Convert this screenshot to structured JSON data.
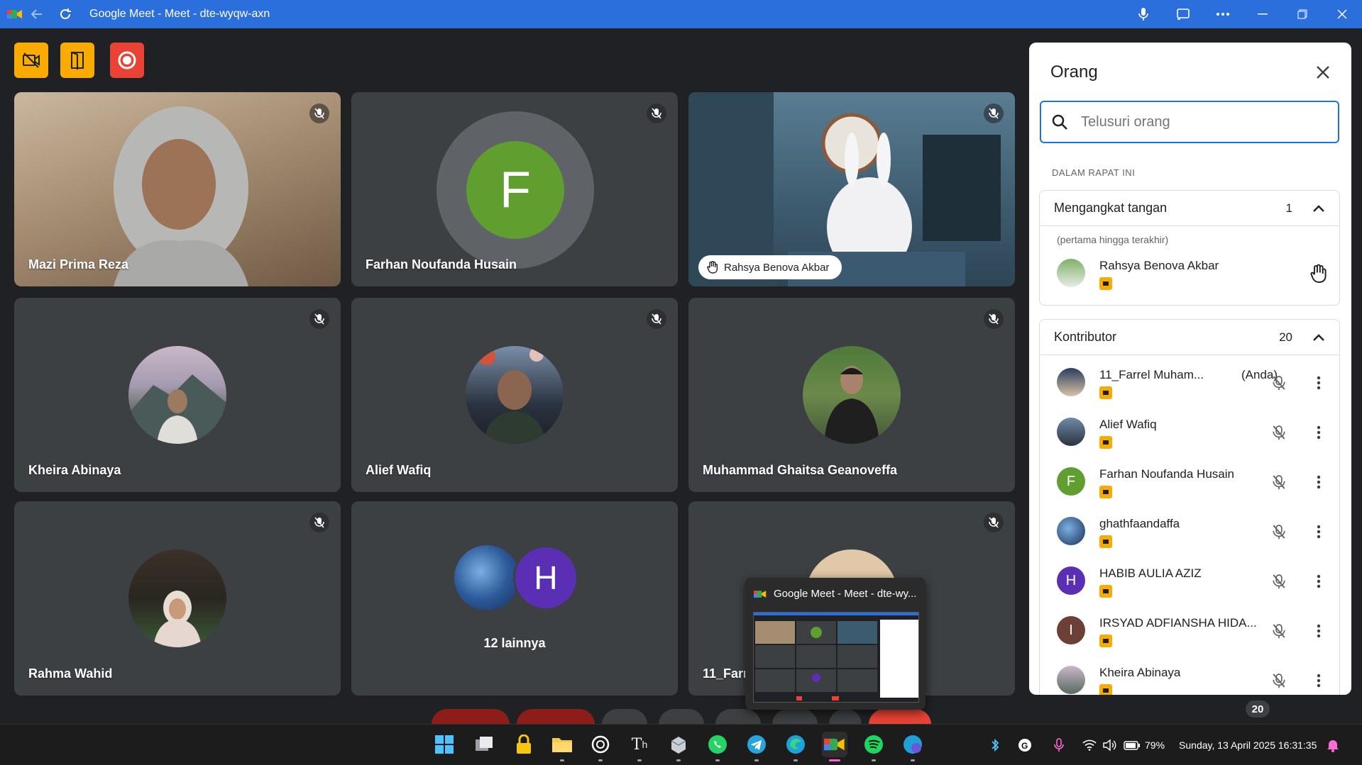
{
  "window": {
    "title": "Google Meet - Meet - dte-wyqw-axn",
    "icons": [
      "meet-app-icon",
      "back-arrow-icon",
      "reload-icon",
      "microphone-icon",
      "cast-icon",
      "more-horizontal-icon",
      "minimize-icon",
      "restore-icon",
      "close-icon"
    ]
  },
  "host_controls": [
    {
      "name": "camera-off-host-control",
      "color": "#f9ab00"
    },
    {
      "name": "exit-host-control",
      "color": "#f9ab00"
    },
    {
      "name": "record-host-control",
      "color": "#ea4335"
    }
  ],
  "tiles": [
    {
      "name": "Mazi Prima Reza",
      "type": "video"
    },
    {
      "name": "Farhan Noufanda Husain",
      "type": "initial",
      "initial": "F",
      "color": "#5f9e2f"
    },
    {
      "name": "Rahsya Benova Akbar",
      "type": "video",
      "hand_raised": true
    },
    {
      "name": "Kheira Abinaya",
      "type": "photo"
    },
    {
      "name": "Alief Wafiq",
      "type": "photo"
    },
    {
      "name": "Muhammad Ghaitsa Geanoveffa",
      "type": "photo"
    },
    {
      "name": "Rahma Wahid",
      "type": "photo"
    },
    {
      "name": "12 lainnya",
      "type": "group",
      "initial": "H"
    },
    {
      "name": "11_Farr",
      "type": "photo"
    }
  ],
  "panel": {
    "title": "Orang",
    "search_placeholder": "Telusuri orang",
    "section_label": "DALAM RAPAT INI",
    "raised_hands": {
      "title": "Mengangkat tangan",
      "count": "1",
      "note": "(pertama hingga terakhir)",
      "people": [
        {
          "name": "Rahsya Benova Akbar"
        }
      ]
    },
    "contributors": {
      "title": "Kontributor",
      "count": "20",
      "people": [
        {
          "name": "11_Farrel Muham...",
          "you": "(Anda)",
          "avatar": "photo"
        },
        {
          "name": "Alief Wafiq",
          "you": "",
          "avatar": "photo"
        },
        {
          "name": "Farhan Noufanda Husain",
          "you": "",
          "avatar": "F",
          "color": "#5f9e2f"
        },
        {
          "name": "ghathfaandaffa",
          "you": "",
          "avatar": "photo"
        },
        {
          "name": "HABIB AULIA AZIZ",
          "you": "",
          "avatar": "H",
          "color": "#5b2fb3"
        },
        {
          "name": "IRSYAD ADFIANSHA HIDA...",
          "you": "",
          "avatar": "I",
          "color": "#6d4037"
        },
        {
          "name": "Kheira Abinaya",
          "you": "",
          "avatar": "photo"
        }
      ]
    }
  },
  "preview": {
    "title": "Google Meet - Meet - dte-wy..."
  },
  "taskbar": {
    "notification_count": "20",
    "battery": "79%",
    "datetime": "Sunday, 13 April 2025  16:31:35",
    "apps": [
      "windows-start-icon",
      "task-view-icon",
      "lock-app-icon",
      "file-explorer-icon",
      "chatgpt-icon",
      "typeface-app-icon",
      "bluestacks-icon",
      "whatsapp-icon",
      "telegram-icon",
      "edge-icon",
      "meet-taskbar-icon",
      "spotify-icon",
      "edge-profile-icon"
    ]
  }
}
